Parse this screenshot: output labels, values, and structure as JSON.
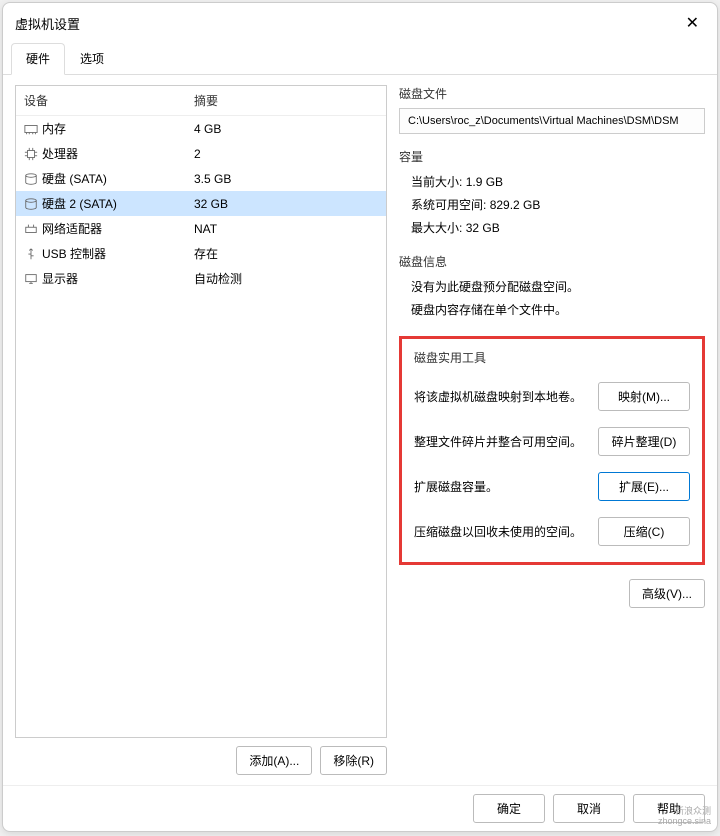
{
  "window": {
    "title": "虚拟机设置"
  },
  "tabs": {
    "hardware": "硬件",
    "options": "选项"
  },
  "headers": {
    "device": "设备",
    "summary": "摘要"
  },
  "devices": [
    {
      "icon": "memory",
      "name": "内存",
      "summary": "4 GB"
    },
    {
      "icon": "cpu",
      "name": "处理器",
      "summary": "2"
    },
    {
      "icon": "disk",
      "name": "硬盘 (SATA)",
      "summary": "3.5 GB"
    },
    {
      "icon": "disk",
      "name": "硬盘 2 (SATA)",
      "summary": "32 GB"
    },
    {
      "icon": "net",
      "name": "网络适配器",
      "summary": "NAT"
    },
    {
      "icon": "usb",
      "name": "USB 控制器",
      "summary": "存在"
    },
    {
      "icon": "display",
      "name": "显示器",
      "summary": "自动检测"
    }
  ],
  "selected_index": 3,
  "left_buttons": {
    "add": "添加(A)...",
    "remove": "移除(R)"
  },
  "disk_file": {
    "title": "磁盘文件",
    "path": "C:\\Users\\roc_z\\Documents\\Virtual Machines\\DSM\\DSM"
  },
  "capacity": {
    "title": "容量",
    "current_label": "当前大小:",
    "current_value": "1.9 GB",
    "free_label": "系统可用空间:",
    "free_value": "829.2 GB",
    "max_label": "最大大小:",
    "max_value": "32 GB"
  },
  "disk_info": {
    "title": "磁盘信息",
    "line1": "没有为此硬盘预分配磁盘空间。",
    "line2": "硬盘内容存储在单个文件中。"
  },
  "tools": {
    "title": "磁盘实用工具",
    "map_desc": "将该虚拟机磁盘映射到本地卷。",
    "map_btn": "映射(M)...",
    "defrag_desc": "整理文件碎片并整合可用空间。",
    "defrag_btn": "碎片整理(D)",
    "expand_desc": "扩展磁盘容量。",
    "expand_btn": "扩展(E)...",
    "compact_desc": "压缩磁盘以回收未使用的空间。",
    "compact_btn": "压缩(C)"
  },
  "advanced": "高级(V)...",
  "footer": {
    "ok": "确定",
    "cancel": "取消",
    "help": "帮助"
  },
  "watermark": {
    "l1": "新浪众测",
    "l2": "zhongce.sina"
  }
}
